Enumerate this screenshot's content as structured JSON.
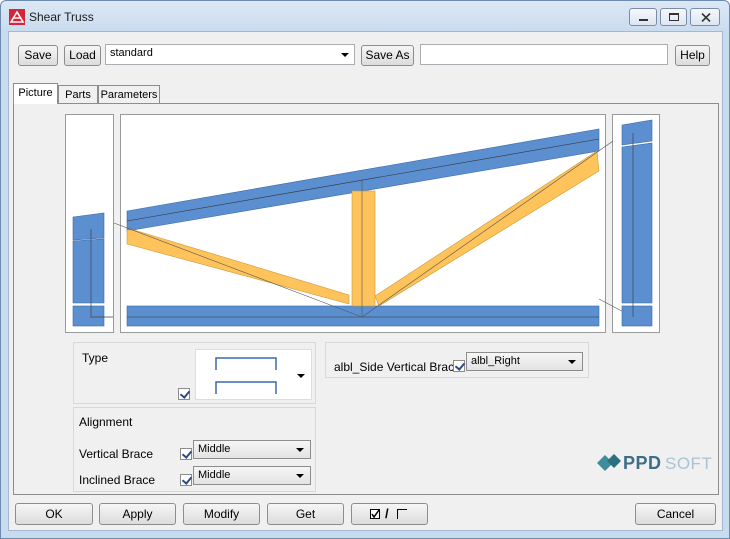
{
  "window": {
    "title": "Shear Truss"
  },
  "toolbar": {
    "save_label": "Save",
    "load_label": "Load",
    "preset_value": "standard",
    "save_as_label": "Save As",
    "save_as_value": "",
    "help_label": "Help"
  },
  "tabs": [
    {
      "label": "Picture",
      "active": true
    },
    {
      "label": "Parts",
      "active": false
    },
    {
      "label": "Parameters",
      "active": false
    }
  ],
  "type_group": {
    "label": "Type",
    "checked": true
  },
  "side_vertical": {
    "label": "albl_Side Vertical Brac",
    "checked": true,
    "value": "albl_Right"
  },
  "alignment": {
    "label": "Alignment",
    "vertical_label": "Vertical Brace",
    "vertical_value": "Middle",
    "vertical_checked": true,
    "inclined_label": "Inclined Brace",
    "inclined_value": "Middle",
    "inclined_checked": true
  },
  "logo": {
    "text_bold": "PPD",
    "text_light": "SOFT"
  },
  "footer": {
    "ok_label": "OK",
    "apply_label": "Apply",
    "modify_label": "Modify",
    "get_label": "Get",
    "toggle_label": "/",
    "cancel_label": "Cancel"
  },
  "colors": {
    "chord": "#5b8fd0",
    "brace": "#ffc35c",
    "frame": "#6d89ad"
  }
}
